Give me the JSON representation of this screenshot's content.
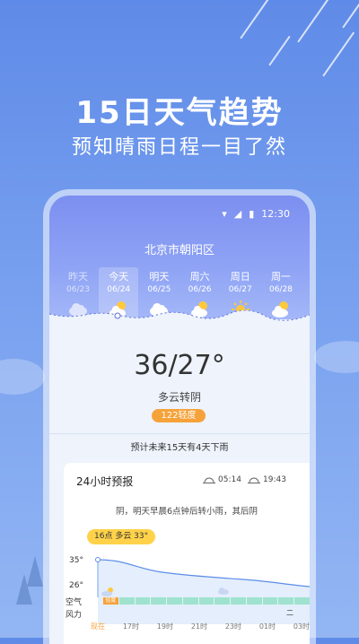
{
  "hero": {
    "title": "15日天气趋势",
    "subtitle": "预知晴雨日程一目了然"
  },
  "status": {
    "time": "12:30"
  },
  "city": "北京市朝阳区",
  "days": [
    {
      "name": "昨天",
      "date": "06/23",
      "icon": "cloud-icon"
    },
    {
      "name": "今天",
      "date": "06/24",
      "icon": "partly-cloudy-icon"
    },
    {
      "name": "明天",
      "date": "06/25",
      "icon": "cloud-icon"
    },
    {
      "name": "周六",
      "date": "06/26",
      "icon": "partly-cloudy-icon"
    },
    {
      "name": "周日",
      "date": "06/27",
      "icon": "sun-icon"
    },
    {
      "name": "周一",
      "date": "06/28",
      "icon": "partly-cloudy-icon"
    }
  ],
  "today": {
    "temp": "36/27°",
    "desc": "多云转阴",
    "aqi": "122轻度",
    "rain_summary": "预计未来15天有4天下雨"
  },
  "hourly": {
    "title": "24小时预报",
    "sunrise": "05:14",
    "sunset": "19:43",
    "forecast": "阴，明天早晨6点钟后转小雨，其后阴",
    "tip": "16点 多云 33°",
    "hi_label": "35°",
    "lo_label": "26°",
    "aqi_label": "空气",
    "aqi_first": "轻度",
    "wind_label": "风力",
    "wind_value": "二",
    "times": [
      "现在",
      "17时",
      "19时",
      "21时",
      "23时",
      "01时",
      "03时"
    ]
  },
  "colors": {
    "accent": "#f6a23a",
    "bg": "#6f96ec",
    "aqi_good": "#9fe3cf",
    "tip": "#ffd24a"
  }
}
